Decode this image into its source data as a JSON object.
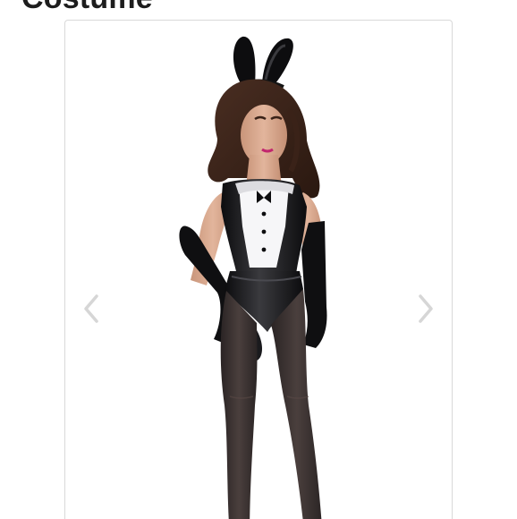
{
  "product": {
    "title": "Costume"
  },
  "gallery": {
    "image_alt": "Costume",
    "prev_icon": "chevron-left-icon",
    "next_icon": "chevron-right-icon"
  },
  "colors": {
    "title_text": "#1d1d1d",
    "border": "#d9d9d9",
    "arrow": "#d6d6d6",
    "costume_black": "#121214",
    "costume_white": "#f6f6f8"
  }
}
